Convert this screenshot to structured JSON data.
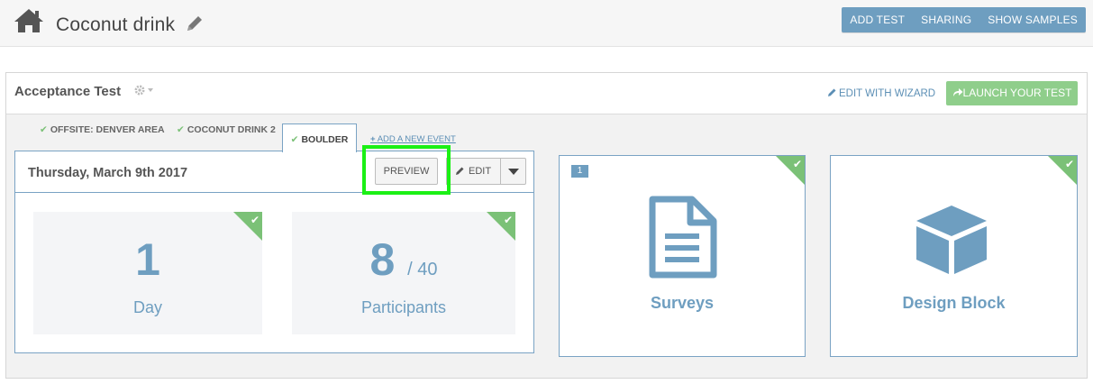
{
  "header": {
    "title": "Coconut drink",
    "actions": [
      "ADD TEST",
      "SHARING",
      "SHOW SAMPLES"
    ]
  },
  "test": {
    "title": "Acceptance Test",
    "edit_wizard_label": "EDIT WITH WIZARD",
    "launch_label": "LAUNCH YOUR TEST"
  },
  "tabs": [
    {
      "label": "OFFSITE: DENVER AREA",
      "done": true,
      "active": false
    },
    {
      "label": "COCONUT DRINK 2",
      "done": true,
      "active": false
    },
    {
      "label": "BOULDER",
      "done": true,
      "active": true
    }
  ],
  "add_event_label": "ADD A NEW EVENT",
  "event": {
    "date": "Thursday, March 9th 2017",
    "preview_label": "PREVIEW",
    "edit_label": "EDIT",
    "stats": [
      {
        "value": "1",
        "suffix": "",
        "label": "Day",
        "done": true
      },
      {
        "value": "8",
        "suffix": "/ 40",
        "label": "Participants",
        "done": true
      }
    ]
  },
  "blocks": [
    {
      "label": "Surveys",
      "count": "1",
      "icon": "document-icon",
      "done": true
    },
    {
      "label": "Design Block",
      "count": "",
      "icon": "cube-icon",
      "done": true
    }
  ],
  "colors": {
    "accent": "#6e9ec0",
    "success": "#7bc177",
    "launch": "#8fce8b",
    "highlight": "#1bf015"
  }
}
